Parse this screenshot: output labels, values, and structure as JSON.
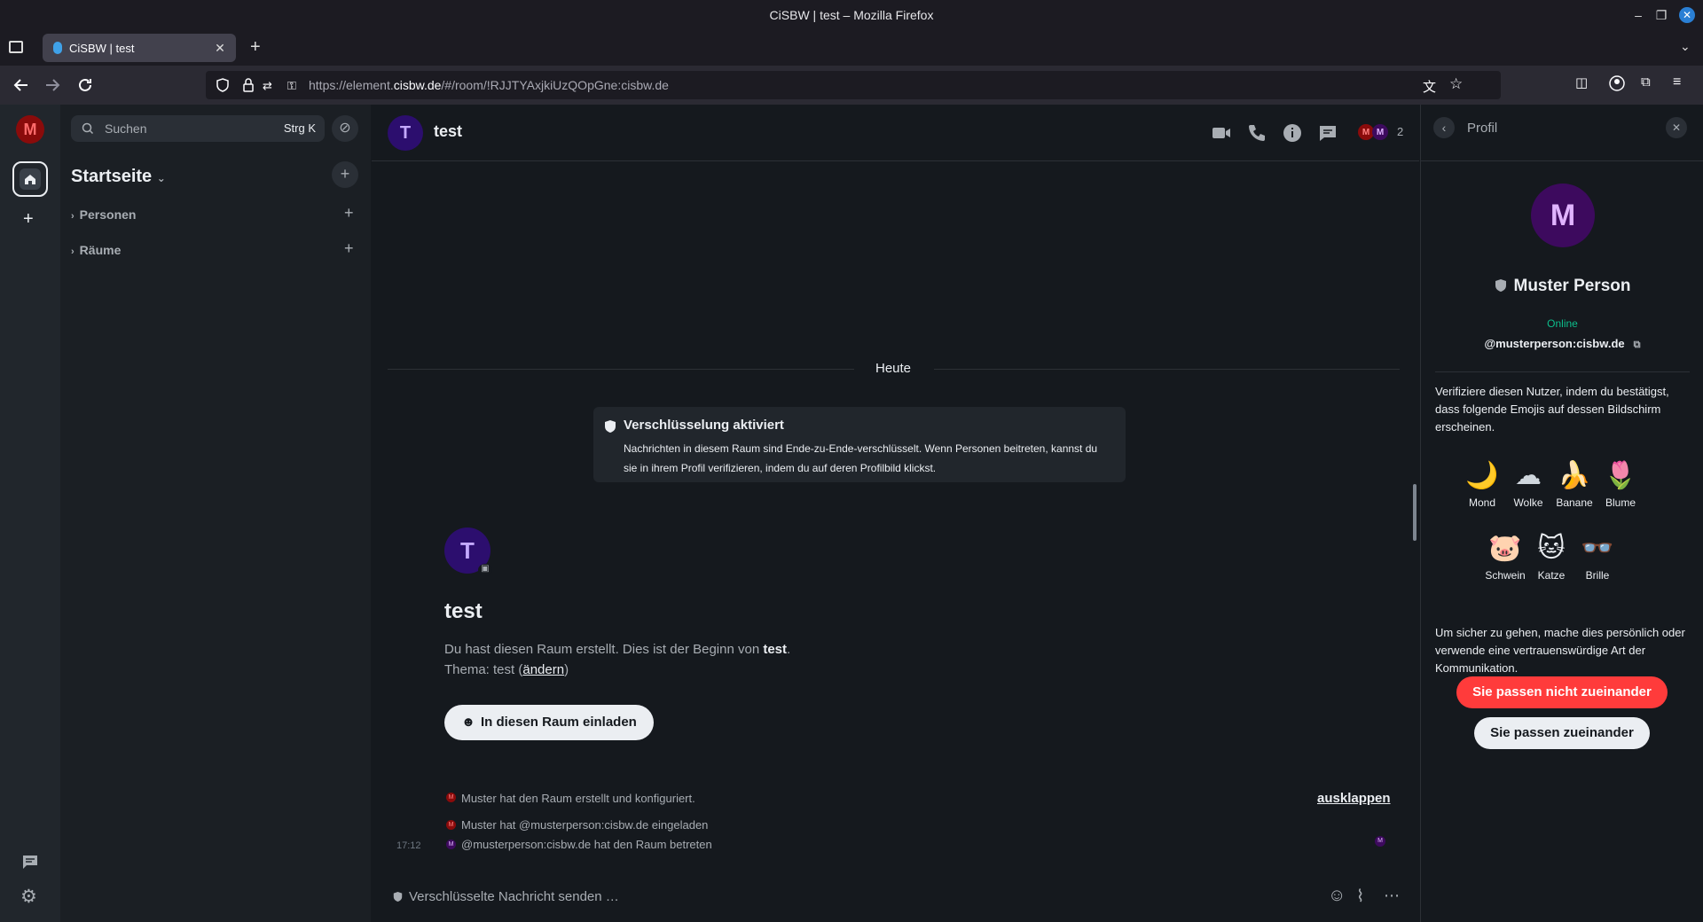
{
  "window": {
    "title": "CiSBW | test – Mozilla Firefox",
    "tab_title": "CiSBW | test",
    "url_prefix": "https://element.",
    "url_domain": "cisbw.de",
    "url_rest": "/#/room/!RJJTYAxjkiUzQOpGne:cisbw.de"
  },
  "spaces": {
    "user_initial": "M"
  },
  "roomlist": {
    "search_placeholder": "Suchen",
    "search_shortcut": "Strg K",
    "home_title": "Startseite",
    "sections": [
      "Personen",
      "Räume"
    ]
  },
  "room": {
    "initial": "T",
    "name": "test",
    "member_initials": [
      "M",
      "M"
    ],
    "member_count": "2",
    "date_separator": "Heute",
    "encryption_title": "Verschlüsselung aktiviert",
    "encryption_text": "Nachrichten in diesem Raum sind Ende-zu-Ende-verschlüsselt. Wenn Personen beitreten, kannst du sie in ihrem Profil verifizieren, indem du auf deren Profilbild klickst.",
    "intro_name": "test",
    "intro_line_prefix": "Du hast diesen Raum erstellt. Dies ist der Beginn von ",
    "intro_line_room": "test",
    "intro_line_suffix": ".",
    "topic_prefix": "Thema: test (",
    "topic_link": "ändern",
    "topic_suffix": ")",
    "invite_button": "In diesen Raum einladen",
    "events": [
      {
        "time": "",
        "initial": "M",
        "text": "Muster hat den Raum erstellt und konfiguriert."
      },
      {
        "time": "",
        "initial": "M",
        "text": "Muster hat @musterperson:cisbw.de eingeladen"
      },
      {
        "time": "17:12",
        "initial": "M",
        "text": "@musterperson:cisbw.de hat den Raum betreten"
      }
    ],
    "expand_link": "ausklappen",
    "composer_placeholder": "Verschlüsselte Nachricht senden …"
  },
  "profile": {
    "panel_title": "Profil",
    "initial": "M",
    "name": "Muster Person",
    "presence": "Online",
    "user_id": "@musterperson:cisbw.de",
    "verify_text": "Verifiziere diesen Nutzer, indem du bestätigst, dass folgende Emojis auf dessen Bildschirm erscheinen.",
    "emojis": [
      {
        "glyph": "🌙",
        "name": "Mond"
      },
      {
        "glyph": "☁",
        "name": "Wolke"
      },
      {
        "glyph": "🍌",
        "name": "Banane"
      },
      {
        "glyph": "🌷",
        "name": "Blume"
      },
      {
        "glyph": "🐷",
        "name": "Schwein"
      },
      {
        "glyph": "🐱",
        "name": "Katze"
      },
      {
        "glyph": "👓",
        "name": "Brille"
      }
    ],
    "safety_text": "Um sicher zu gehen, mache dies persönlich oder verwende eine vertrauenswürdige Art der Kommunikation.",
    "mismatch_button": "Sie passen nicht zueinander",
    "match_button": "Sie passen zueinander"
  },
  "colors": {
    "accent_green": "#0dbd8b",
    "user_avatar": "#8a0b0b",
    "room_avatar": "#2c0e6e",
    "profile_avatar": "#3d0a5e",
    "danger": "#ff3b3b"
  }
}
